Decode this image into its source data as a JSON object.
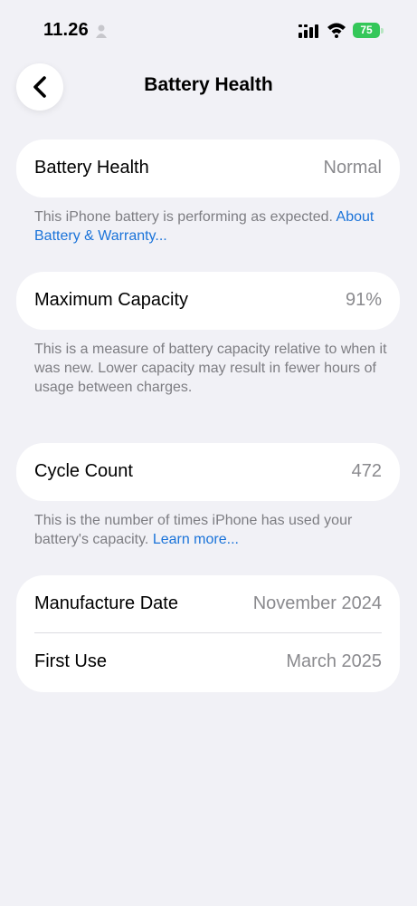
{
  "status_bar": {
    "time": "11.26",
    "battery_level": "75"
  },
  "nav": {
    "title": "Battery Health",
    "back_icon": "chevron-left-icon"
  },
  "battery_health": {
    "label": "Battery Health",
    "value": "Normal",
    "footnote_text": "This iPhone battery is performing as expected. ",
    "footnote_link": "About Battery & Warranty..."
  },
  "max_capacity": {
    "label": "Maximum Capacity",
    "value": "91%",
    "footnote_text": "This is a measure of battery capacity relative to when it was new. Lower capacity may result in fewer hours of usage between charges."
  },
  "cycle_count": {
    "label": "Cycle Count",
    "value": "472",
    "footnote_text": "This is the number of times iPhone has used your battery's capacity. ",
    "footnote_link": "Learn more..."
  },
  "dates": {
    "manufacture_label": "Manufacture Date",
    "manufacture_value": "November 2024",
    "first_use_label": "First Use",
    "first_use_value": "March 2025"
  },
  "colors": {
    "background": "#f1f1f6",
    "link": "#1a73d9",
    "battery_green": "#34c759"
  }
}
